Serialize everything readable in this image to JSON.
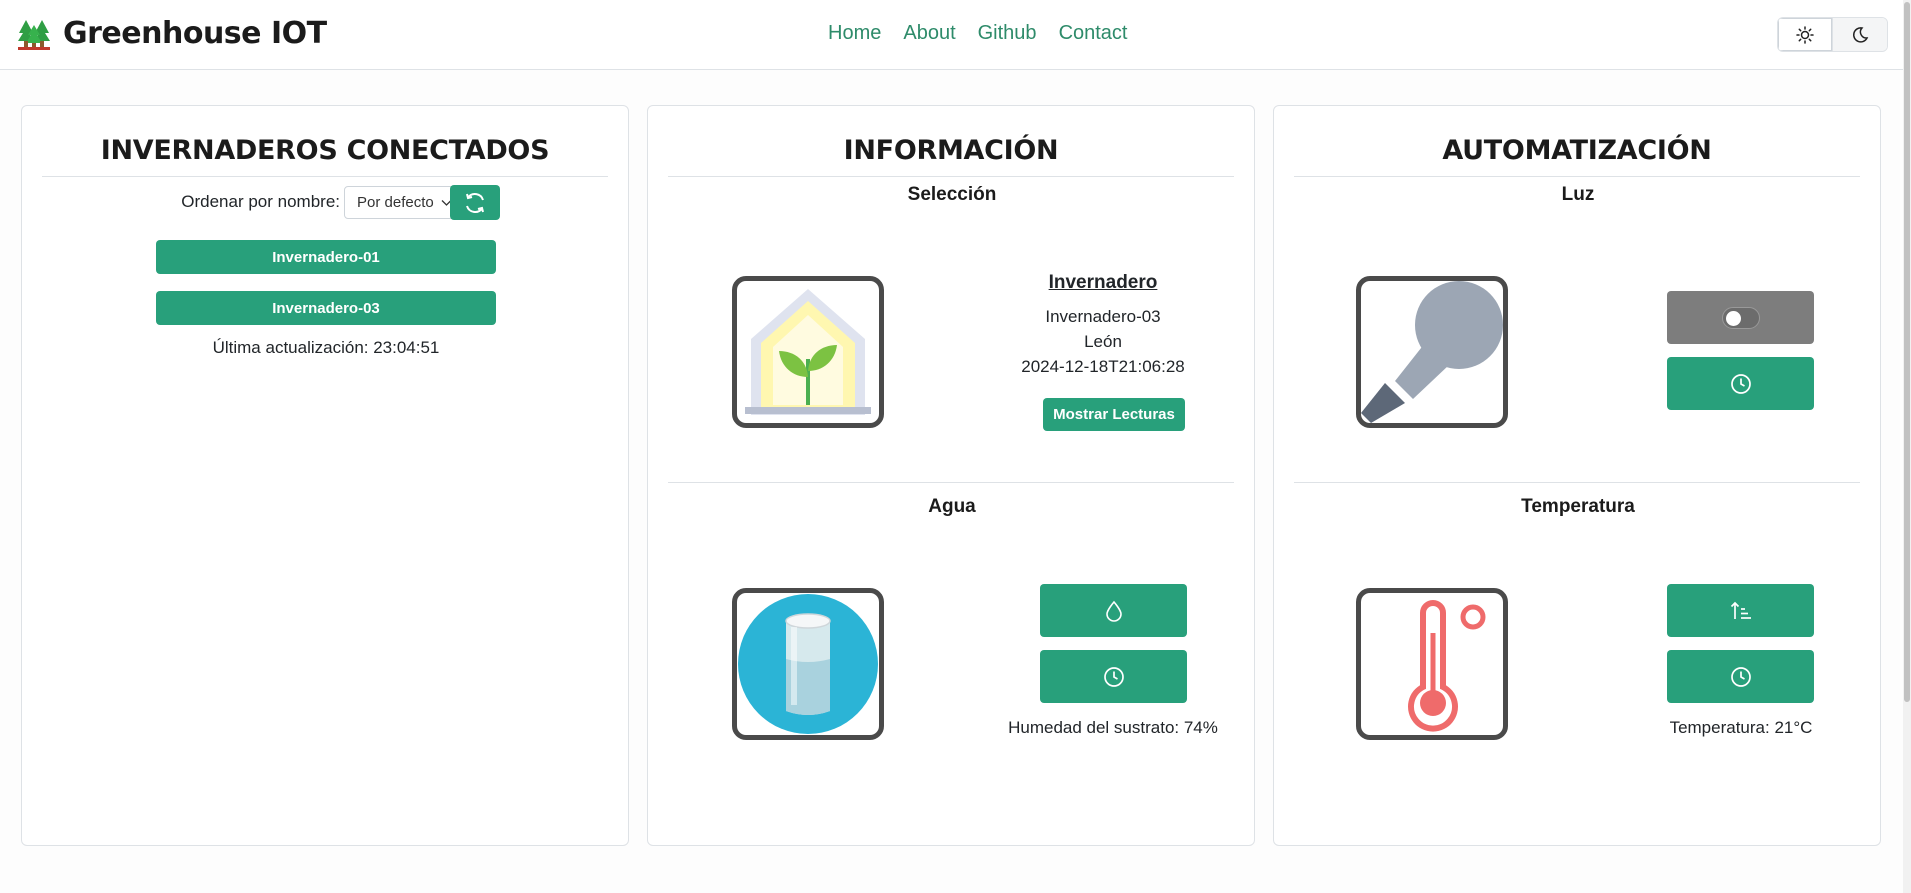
{
  "navbar": {
    "brand": "Greenhouse IOT",
    "links": [
      "Home",
      "About",
      "Github",
      "Contact"
    ],
    "theme_light_icon": "sun-icon",
    "theme_dark_icon": "moon-icon"
  },
  "left": {
    "title": "INVERNADEROS CONECTADOS",
    "sort_label": "Ordenar por nombre:",
    "sort_value": "Por defecto",
    "greenhouses": [
      "Invernadero-01",
      "Invernadero-03"
    ],
    "last_update": "Última actualización: 23:04:51"
  },
  "center": {
    "title": "INFORMACIÓN",
    "selection_title": "Selección",
    "info_heading": "Invernadero",
    "info_name": "Invernadero-03",
    "info_location": "León",
    "info_date": "2024-12-18T21:06:28",
    "show_readings": "Mostrar Lecturas",
    "water_title": "Agua",
    "humidity": "Humedad del sustrato: 74%"
  },
  "right": {
    "title": "AUTOMATIZACIÓN",
    "light_title": "Luz",
    "temp_title": "Temperatura",
    "temperature": "Temperatura: 21°C"
  },
  "colors": {
    "accent": "#28a07b",
    "nav_link": "#2e8b6a",
    "toggle_off": "#7d7d7d"
  }
}
